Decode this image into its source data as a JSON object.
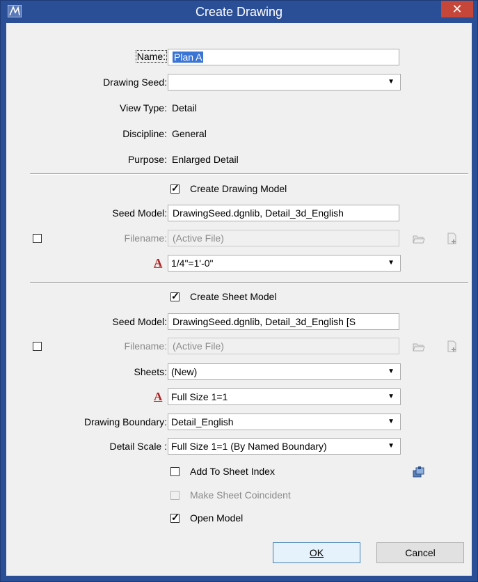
{
  "window": {
    "title": "Create Drawing",
    "close": "✕"
  },
  "header": {
    "name_label": "Name:",
    "name_value": "Plan A",
    "seed_label": "Drawing Seed:",
    "seed_value": "",
    "view_type_label": "View Type:",
    "view_type_value": "Detail",
    "discipline_label": "Discipline:",
    "discipline_value": "General",
    "purpose_label": "Purpose:",
    "purpose_value": "Enlarged Detail"
  },
  "drawing_model": {
    "create_label": "Create Drawing Model",
    "create_checked": true,
    "seed_model_label": "Seed Model:",
    "seed_model_value": "DrawingSeed.dgnlib, Detail_3d_English",
    "filename_label": "Filename:",
    "filename_value": "(Active File)",
    "annotation_scale": "1/4\"=1'-0\""
  },
  "sheet_model": {
    "create_label": "Create Sheet Model",
    "create_checked": true,
    "seed_model_label": "Seed Model:",
    "seed_model_value": "DrawingSeed.dgnlib, Detail_3d_English [S",
    "filename_label": "Filename:",
    "filename_value": "(Active File)",
    "sheets_label": "Sheets:",
    "sheets_value": "(New)",
    "annotation_scale": "Full Size 1=1",
    "boundary_label": "Drawing Boundary:",
    "boundary_value": "Detail_English",
    "detail_scale_label": "Detail Scale :",
    "detail_scale_value": "Full Size 1=1 (By Named Boundary)",
    "add_index_label": "Add To Sheet Index",
    "coincident_label": "Make Sheet Coincident",
    "open_model_label": "Open Model"
  },
  "buttons": {
    "ok": "OK",
    "cancel": "Cancel"
  },
  "colors": {
    "titlebar": "#2b4f97",
    "close": "#c7463a",
    "selection": "#3a74d4",
    "scale_icon": "#b02020"
  },
  "icons": [
    "app-icon",
    "close-icon",
    "open-folder-icon",
    "new-file-icon",
    "annotation-scale-icon",
    "sheet-index-icon",
    "dropdown-arrow-icon"
  ]
}
